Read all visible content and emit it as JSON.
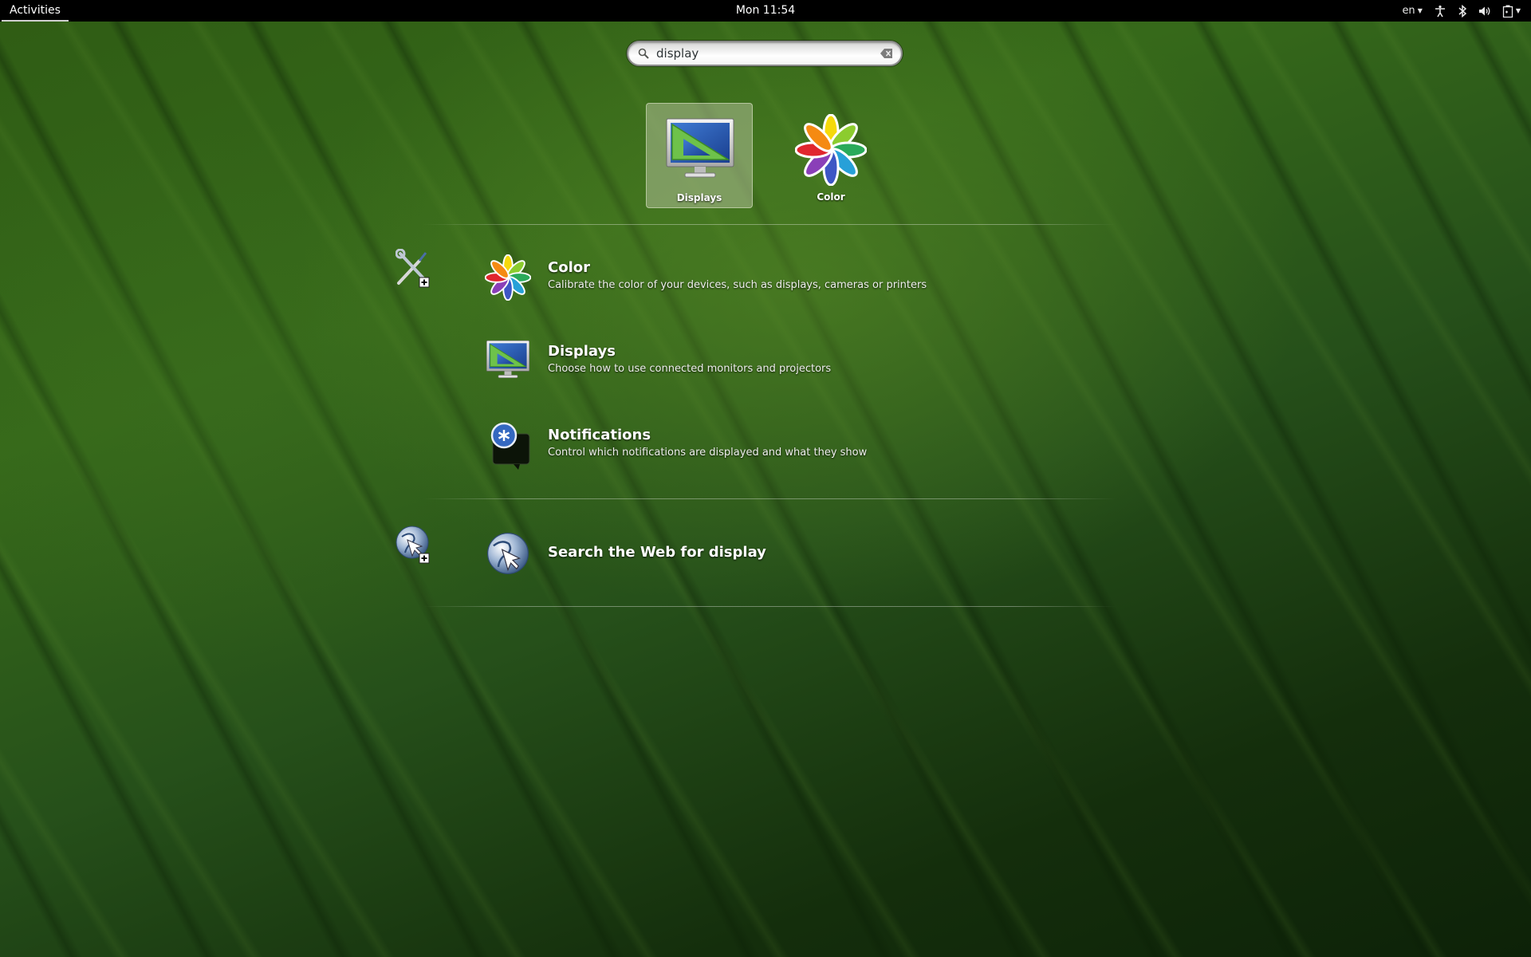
{
  "topbar": {
    "activities_label": "Activities",
    "clock": "Mon 11:54",
    "language": "en",
    "tray_icons": [
      "accessibility-icon",
      "bluetooth-icon",
      "volume-icon",
      "battery-icon"
    ]
  },
  "search": {
    "value": "display",
    "icon": "search-icon",
    "clear_icon": "clear-icon"
  },
  "apps": [
    {
      "label": "Displays",
      "icon": "displays-icon",
      "selected": true
    },
    {
      "label": "Color",
      "icon": "color-icon",
      "selected": false
    }
  ],
  "providers": [
    {
      "icon": "settings-icon"
    },
    {
      "icon": "web-browser-icon"
    }
  ],
  "results": [
    {
      "title": "Color",
      "description": "Calibrate the color of your devices, such as displays, cameras or printers",
      "icon": "color-icon"
    },
    {
      "title": "Displays",
      "description": "Choose how to use connected monitors and projectors",
      "icon": "displays-icon"
    },
    {
      "title": "Notifications",
      "description": "Control which notifications are displayed and what they show",
      "icon": "notifications-icon"
    }
  ],
  "web_search": {
    "title": "Search the Web for display",
    "icon": "globe-icon"
  },
  "colors": {
    "topbar": "#000000",
    "wallpaper": "#2f5c14",
    "selection": "#afbe96"
  }
}
